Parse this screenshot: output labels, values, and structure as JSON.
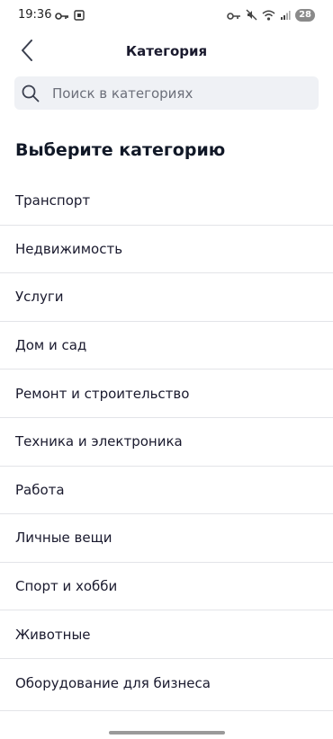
{
  "status_bar": {
    "time": "19:36",
    "battery": "28",
    "left_icons": [
      "key-icon",
      "screenshot-icon"
    ],
    "right_icons": [
      "vpn-key-icon",
      "mute-icon",
      "wifi-icon",
      "signal-icon"
    ]
  },
  "header": {
    "title": "Категория",
    "back_icon": "chevron-left-icon"
  },
  "search": {
    "placeholder": "Поиск в категориях",
    "value": ""
  },
  "section_title": "Выберите категорию",
  "categories": [
    "Транспорт",
    "Недвижимость",
    "Услуги",
    "Дом и сад",
    "Ремонт и строительство",
    "Техника и электроника",
    "Работа",
    "Личные вещи",
    "Спорт и хобби",
    "Животные",
    "Оборудование для бизнеса"
  ],
  "colors": {
    "text": "#1a1a2e",
    "search_bg": "#eff1f5",
    "divider": "#e3e4e8",
    "placeholder": "#6c6f7a"
  }
}
